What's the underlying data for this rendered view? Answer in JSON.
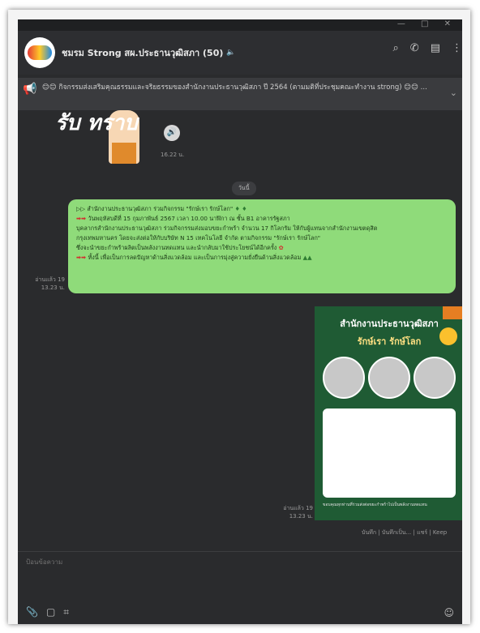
{
  "window": {
    "controls": "— □ ✕"
  },
  "header": {
    "title": "ชมรม Strong สผ.ประธานวุฒิสภา (50)",
    "mute_icon": "🔈",
    "icons": [
      "search-icon",
      "call-icon",
      "menu-icon",
      "more-icon"
    ],
    "glyphs": [
      "⌕",
      "✆",
      "▤",
      "⋮"
    ]
  },
  "announcement": {
    "text": "😊😊 กิจกรรมส่งเสริมคุณธรรมและจริยธรรมของสำนักงานประธานวุฒิสภา ปี 2564 (ตามมติที่ประชุมคณะทำงาน strong) 😊😊 ..."
  },
  "messages": {
    "sticker_text": "รับ ทราบ",
    "voice_time": "16.22 น.",
    "date_separator": "วันนี้",
    "bubble_lines": [
      "สำนักงานประธานวุฒิสภา ร่วมกิจกรรม \"รักษ์เรา รักษ์โลก\"",
      "วันพฤหัสบดีที่ 15 กุมภาพันธ์ 2567 เวลา 10.00 นาฬิกา ณ ชั้น B1 อาคารรัฐสภา",
      "บุคลากรสำนักงานประธานวุฒิสภา ร่วมกิจกรรมส่งมอบขยะกำพร้า จำนวน 17 กิโลกรัม ให้กับผู้แทนจากสำนักงานเขตดุสิต",
      "กรุงเทพมหานคร โดยจะส่งต่อให้กับบริษัท N 15 เทคโนโลยี จำกัด ตามกิจกรรม \"รักษ์เรา รักษ์โลก\"",
      "ซึ่งจะนำขยะกำพร้าผลิตเป็นพลังงานทดแทน และนำกลับมาใช้ประโยชน์ได้อีกครั้ง",
      "ทั้งนี้ เพื่อเป็นการลดปัญหาด้านสิ่งแวดล้อม และเป็นการมุ่งสู่ความยั่งยืนด้านสิ่งแวดล้อม"
    ],
    "bubble_read": "อ่านแล้ว 19",
    "bubble_time": "13.23 น.",
    "poster_title": "สำนักงานประธานวุฒิสภา",
    "poster_subtitle": "รักษ์เรา รักษ์โลก",
    "poster_footer": "ขอบคุณทุกท่านที่ร่วมส่งต่อขยะกำพร้าไปเป็นพลังงานทดแทน",
    "poster_read": "อ่านแล้ว 19",
    "poster_time": "13.23 น.",
    "poster_links": "บันทึก | บันทึกเป็น... | แชร์ | Keep"
  },
  "input": {
    "placeholder": "ป้อนข้อความ",
    "tools": [
      "attach-icon",
      "save-icon",
      "crop-icon"
    ],
    "glyphs": [
      "📎",
      "▢",
      "⌗"
    ],
    "emoji_glyph": "☺"
  }
}
